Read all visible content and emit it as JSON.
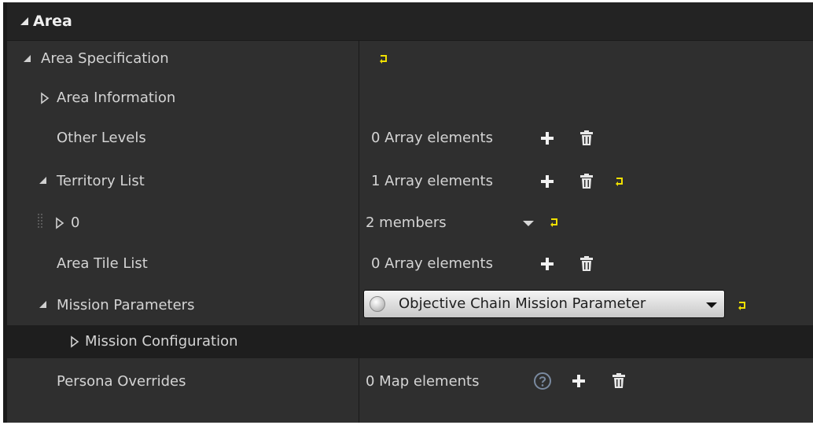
{
  "header": {
    "title": "Area"
  },
  "rows": {
    "area_specification": {
      "label": "Area Specification"
    },
    "area_information": {
      "label": "Area Information"
    },
    "other_levels": {
      "label": "Other Levels",
      "value": "0 Array elements"
    },
    "territory_list": {
      "label": "Territory List",
      "value": "1 Array elements"
    },
    "territory_item_0": {
      "label": "0",
      "value": "2 members"
    },
    "area_tile_list": {
      "label": "Area Tile List",
      "value": "0 Array elements"
    },
    "mission_parameters": {
      "label": "Mission Parameters",
      "value": "Objective Chain Mission Parameter"
    },
    "mission_configuration": {
      "label": "Mission Configuration"
    },
    "persona_overrides": {
      "label": "Persona Overrides",
      "value": "0 Map elements"
    }
  },
  "icons": {
    "add": "plus-icon",
    "delete": "trash-icon",
    "reset": "reset-to-default-icon",
    "help": "help-icon",
    "expand": "expand-arrow-icon",
    "collapse": "collapse-arrow-icon"
  },
  "colors": {
    "panel_bg": "#2f2f2f",
    "header_bg": "#232323",
    "selected_row_bg": "#1e1e1e",
    "text": "#d4d4d4",
    "reset_icon": "#f0e000"
  }
}
